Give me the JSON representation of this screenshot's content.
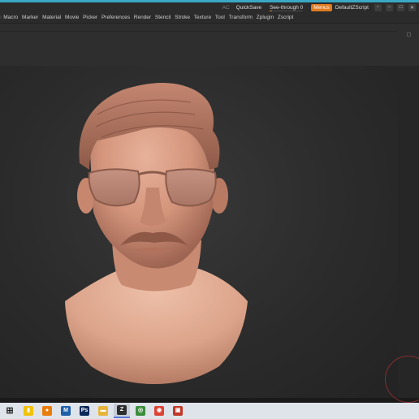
{
  "titlebar": {
    "ac": "AC",
    "quicksave": "QuickSave",
    "see_through": "See-through  0",
    "see_through_level": 0,
    "menus": "Menus",
    "script": "DefaultZScript",
    "window_icons": [
      "restore-icon",
      "minimize-icon",
      "maximize-icon",
      "close-icon"
    ]
  },
  "menu_bar": {
    "items": [
      "Macro",
      "Marker",
      "Material",
      "Movie",
      "Picker",
      "Preferences",
      "Render",
      "Stencil",
      "Stroke",
      "Texture",
      "Tool",
      "Transform",
      "Zplugin",
      "Zscript"
    ]
  },
  "taskbar": {
    "apps": [
      {
        "name": "start-icon",
        "color": "#1f1f1f"
      },
      {
        "name": "file-explorer-icon",
        "color": "#f1c20a"
      },
      {
        "name": "blender-icon",
        "color": "#e87d0d"
      },
      {
        "name": "marvelous-icon",
        "color": "#1f5fa8"
      },
      {
        "name": "photoshop-icon",
        "color": "#0b2a59"
      },
      {
        "name": "folder-icon",
        "color": "#e6b43a"
      },
      {
        "name": "zbrush-icon",
        "color": "#2d2d2d"
      },
      {
        "name": "chrome-like-icon",
        "color": "#3c8d3c"
      },
      {
        "name": "chrome-icon",
        "color": "#db4437"
      },
      {
        "name": "zip-icon",
        "color": "#c0392b"
      }
    ]
  },
  "colors": {
    "accent": "#3aa8c4",
    "menus_button": "#e07b20",
    "clay": "#d89a80"
  }
}
